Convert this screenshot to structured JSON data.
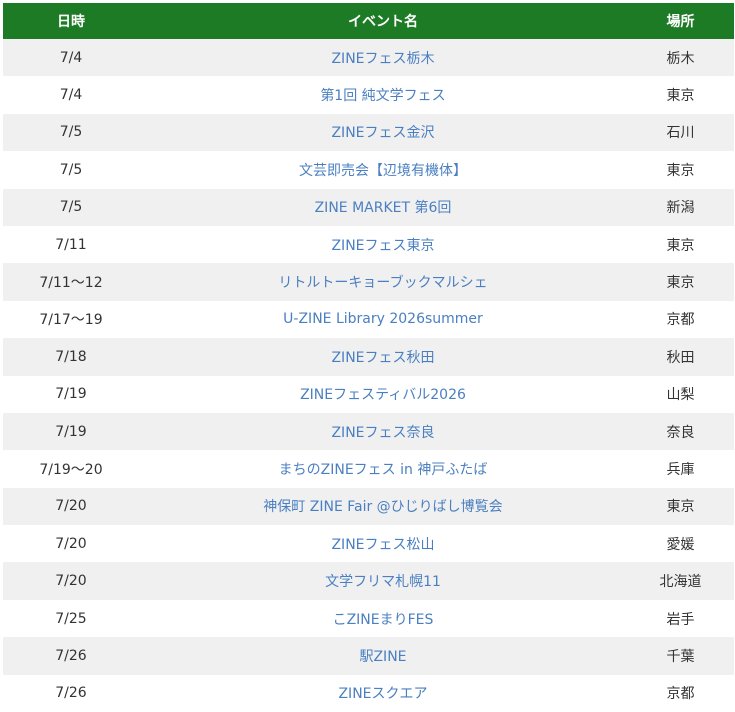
{
  "table": {
    "headers": {
      "date": "日時",
      "event": "イベント名",
      "place": "場所"
    },
    "rows": [
      {
        "date": "7/4",
        "event": "ZINEフェス栃木",
        "place": "栃木"
      },
      {
        "date": "7/4",
        "event": "第1回 純文学フェス",
        "place": "東京"
      },
      {
        "date": "7/5",
        "event": "ZINEフェス金沢",
        "place": "石川"
      },
      {
        "date": "7/5",
        "event": "文芸即売会【辺境有機体】",
        "place": "東京"
      },
      {
        "date": "7/5",
        "event": "ZINE MARKET 第6回",
        "place": "新潟"
      },
      {
        "date": "7/11",
        "event": "ZINEフェス東京",
        "place": "東京"
      },
      {
        "date": "7/11〜12",
        "event": "リトルトーキョーブックマルシェ",
        "place": "東京"
      },
      {
        "date": "7/17〜19",
        "event": "U-ZINE Library 2026summer",
        "place": "京都"
      },
      {
        "date": "7/18",
        "event": "ZINEフェス秋田",
        "place": "秋田"
      },
      {
        "date": "7/19",
        "event": "ZINEフェスティバル2026",
        "place": "山梨"
      },
      {
        "date": "7/19",
        "event": "ZINEフェス奈良",
        "place": "奈良"
      },
      {
        "date": "7/19〜20",
        "event": "まちのZINEフェス in 神戸ふたば",
        "place": "兵庫"
      },
      {
        "date": "7/20",
        "event": "神保町 ZINE Fair @ひじりばし博覧会",
        "place": "東京"
      },
      {
        "date": "7/20",
        "event": "ZINEフェス松山",
        "place": "愛媛"
      },
      {
        "date": "7/20",
        "event": "文学フリマ札幌11",
        "place": "北海道"
      },
      {
        "date": "7/25",
        "event": "こZINEまりFES",
        "place": "岩手"
      },
      {
        "date": "7/26",
        "event": "駅ZINE",
        "place": "千葉"
      },
      {
        "date": "7/26",
        "event": "ZINEスクエア",
        "place": "京都"
      }
    ]
  },
  "colors": {
    "header_bg": "#1d7b25",
    "header_text": "#ffffff",
    "link": "#4a7fc1",
    "row_alt": "#f0f0f0"
  }
}
